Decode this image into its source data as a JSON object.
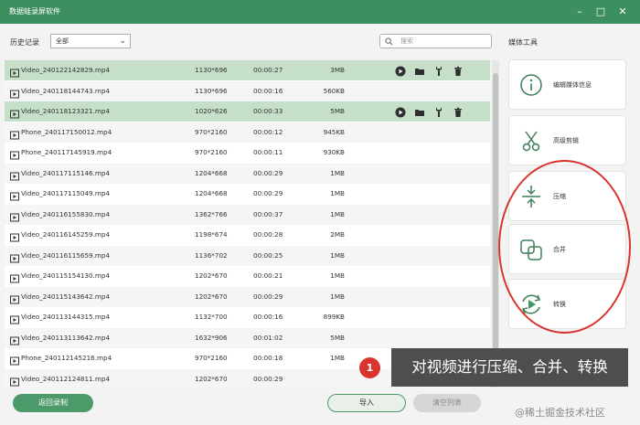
{
  "window": {
    "title": "数据蛙录屏软件"
  },
  "toolbar": {
    "history_label": "历史记录",
    "filter_value": "全部",
    "search_placeholder": "搜索"
  },
  "files": [
    {
      "name": "Video_240122142829.mp4",
      "resolution": "1130*696",
      "duration": "00:00:27",
      "size": "3MB",
      "selected": true
    },
    {
      "name": "Video_240118144743.mp4",
      "resolution": "1130*696",
      "duration": "00:00:16",
      "size": "560KB",
      "selected": false
    },
    {
      "name": "Video_240118123321.mp4",
      "resolution": "1020*626",
      "duration": "00:00:33",
      "size": "5MB",
      "selected": true
    },
    {
      "name": "Phone_240117150012.mp4",
      "resolution": "970*2160",
      "duration": "00:00:12",
      "size": "945KB",
      "selected": false
    },
    {
      "name": "Phone_240117145919.mp4",
      "resolution": "970*2160",
      "duration": "00:00:11",
      "size": "930KB",
      "selected": false
    },
    {
      "name": "Video_240117115146.mp4",
      "resolution": "1204*668",
      "duration": "00:00:29",
      "size": "1MB",
      "selected": false
    },
    {
      "name": "Video_240117115049.mp4",
      "resolution": "1204*668",
      "duration": "00:00:29",
      "size": "1MB",
      "selected": false
    },
    {
      "name": "Video_240116155830.mp4",
      "resolution": "1362*766",
      "duration": "00:00:37",
      "size": "1MB",
      "selected": false
    },
    {
      "name": "Video_240116145259.mp4",
      "resolution": "1198*674",
      "duration": "00:00:28",
      "size": "2MB",
      "selected": false
    },
    {
      "name": "Video_240116115659.mp4",
      "resolution": "1136*702",
      "duration": "00:00:25",
      "size": "1MB",
      "selected": false
    },
    {
      "name": "Video_240115154130.mp4",
      "resolution": "1202*670",
      "duration": "00:00:21",
      "size": "1MB",
      "selected": false
    },
    {
      "name": "Video_240115143642.mp4",
      "resolution": "1202*670",
      "duration": "00:00:29",
      "size": "1MB",
      "selected": false
    },
    {
      "name": "Video_240113144315.mp4",
      "resolution": "1132*700",
      "duration": "00:00:16",
      "size": "899KB",
      "selected": false
    },
    {
      "name": "Video_240113113642.mp4",
      "resolution": "1632*906",
      "duration": "00:01:02",
      "size": "5MB",
      "selected": false
    },
    {
      "name": "Phone_240112145216.mp4",
      "resolution": "970*2160",
      "duration": "00:00:18",
      "size": "1MB",
      "selected": false
    },
    {
      "name": "Video_240112124811.mp4",
      "resolution": "1202*670",
      "duration": "00:00:29",
      "size": "",
      "selected": false
    }
  ],
  "row_action_icons": [
    "play-icon",
    "folder-icon",
    "wrench-icon",
    "trash-icon"
  ],
  "media_tools": {
    "title": "媒体工具",
    "items": [
      {
        "label": "编辑媒体信息",
        "icon": "info-icon"
      },
      {
        "label": "高级剪辑",
        "icon": "scissors-icon"
      },
      {
        "label": "压缩",
        "icon": "compress-icon"
      },
      {
        "label": "合并",
        "icon": "merge-icon"
      },
      {
        "label": "转换",
        "icon": "convert-icon"
      }
    ]
  },
  "footer": {
    "back_label": "返回录制",
    "import_label": "导入",
    "clear_label": "清空列表"
  },
  "annotation": {
    "badge": "1",
    "text": "对视频进行压缩、合并、转换"
  },
  "watermark": "@稀土掘金技术社区",
  "colors": {
    "titlebar": "#3e8f5f",
    "accent": "#4c9a6a",
    "selected_row": "#c5dfc9",
    "annotation_red": "#d9342f"
  }
}
